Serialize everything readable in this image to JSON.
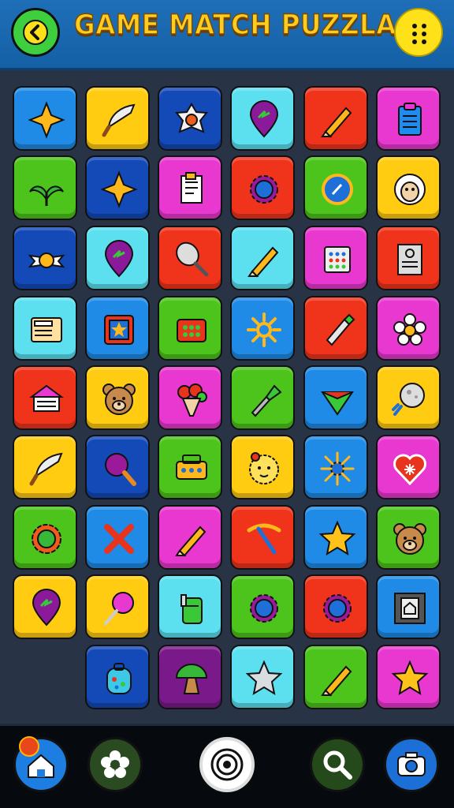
{
  "header": {
    "title": "GAME MATCH PUZZLA",
    "back_icon": "back-arrow-icon",
    "menu_icon": "more-dots-icon"
  },
  "colors": {
    "blue": "#1f8be6",
    "yellow": "#ffcc12",
    "darkblue": "#1449b8",
    "cyan": "#5ce0f0",
    "red": "#f0341c",
    "magenta": "#e838d0",
    "green": "#4cc41c",
    "purple": "#7a1a8a"
  },
  "board": {
    "rows": [
      [
        {
          "icon": "star-icon",
          "color": "blue"
        },
        {
          "icon": "feather-icon",
          "color": "yellow"
        },
        {
          "icon": "flower-badge-icon",
          "color": "darkblue"
        },
        {
          "icon": "map-pin-icon",
          "color": "cyan"
        },
        {
          "icon": "pencil-icon",
          "color": "red"
        },
        {
          "icon": "clipboard-icon",
          "color": "magenta"
        }
      ],
      [
        {
          "icon": "palm-leaf-icon",
          "color": "green"
        },
        {
          "icon": "star-icon",
          "color": "darkblue"
        },
        {
          "icon": "document-icon",
          "color": "magenta"
        },
        {
          "icon": "gear-icon",
          "color": "red"
        },
        {
          "icon": "compass-icon",
          "color": "green"
        },
        {
          "icon": "sheep-face-icon",
          "color": "yellow"
        }
      ],
      [
        {
          "icon": "ribbon-icon",
          "color": "darkblue"
        },
        {
          "icon": "map-pin-icon",
          "color": "cyan"
        },
        {
          "icon": "racket-icon",
          "color": "red"
        },
        {
          "icon": "pencil-icon",
          "color": "cyan"
        },
        {
          "icon": "calculator-icon",
          "color": "magenta"
        },
        {
          "icon": "id-card-icon",
          "color": "red"
        }
      ],
      [
        {
          "icon": "cash-register-icon",
          "color": "cyan"
        },
        {
          "icon": "picture-frame-icon",
          "color": "blue"
        },
        {
          "icon": "dice-box-icon",
          "color": "green"
        },
        {
          "icon": "sun-gear-icon",
          "color": "blue"
        },
        {
          "icon": "marker-icon",
          "color": "red"
        },
        {
          "icon": "daisy-icon",
          "color": "magenta"
        }
      ],
      [
        {
          "icon": "cabin-icon",
          "color": "red"
        },
        {
          "icon": "bear-face-icon",
          "color": "yellow"
        },
        {
          "icon": "bouquet-icon",
          "color": "magenta"
        },
        {
          "icon": "dropper-icon",
          "color": "green"
        },
        {
          "icon": "gem-icon",
          "color": "blue"
        },
        {
          "icon": "moon-rocket-icon",
          "color": "yellow"
        }
      ],
      [
        {
          "icon": "feather-icon",
          "color": "yellow"
        },
        {
          "icon": "magnifier-icon",
          "color": "darkblue"
        },
        {
          "icon": "radio-icon",
          "color": "green"
        },
        {
          "icon": "lion-face-icon",
          "color": "yellow"
        },
        {
          "icon": "splash-star-icon",
          "color": "blue"
        },
        {
          "icon": "heart-shield-icon",
          "color": "magenta"
        }
      ],
      [
        {
          "icon": "sun-icon",
          "color": "green"
        },
        {
          "icon": "x-mark-icon",
          "color": "blue"
        },
        {
          "icon": "pencil-icon",
          "color": "magenta"
        },
        {
          "icon": "pickaxe-icon",
          "color": "red"
        },
        {
          "icon": "gold-star-icon",
          "color": "blue"
        },
        {
          "icon": "bear-face-icon",
          "color": "green"
        }
      ],
      [
        {
          "icon": "map-pin-icon",
          "color": "yellow"
        },
        {
          "icon": "lollipop-icon",
          "color": "yellow"
        },
        {
          "icon": "jar-icon",
          "color": "cyan"
        },
        {
          "icon": "gear-icon",
          "color": "green"
        },
        {
          "icon": "gear-icon",
          "color": "red"
        },
        {
          "icon": "film-frame-icon",
          "color": "blue"
        }
      ],
      [
        null,
        {
          "icon": "backpack-icon",
          "color": "darkblue"
        },
        {
          "icon": "mushroom-icon",
          "color": "purple"
        },
        {
          "icon": "silver-star-icon",
          "color": "cyan"
        },
        {
          "icon": "pencil-icon",
          "color": "green"
        },
        {
          "icon": "gold-star-icon",
          "color": "magenta"
        }
      ]
    ]
  },
  "bottom_nav": [
    {
      "name": "home",
      "icon": "home-icon",
      "bg": "#1d7de0"
    },
    {
      "name": "settings",
      "icon": "flower-settings-icon",
      "bg": "#2a4a22"
    },
    {
      "name": "target",
      "icon": "target-icon",
      "bg": "#ffffff"
    },
    {
      "name": "search",
      "icon": "search-icon",
      "bg": "#244a1c"
    },
    {
      "name": "camera",
      "icon": "camera-icon",
      "bg": "#1d6fd8"
    }
  ]
}
